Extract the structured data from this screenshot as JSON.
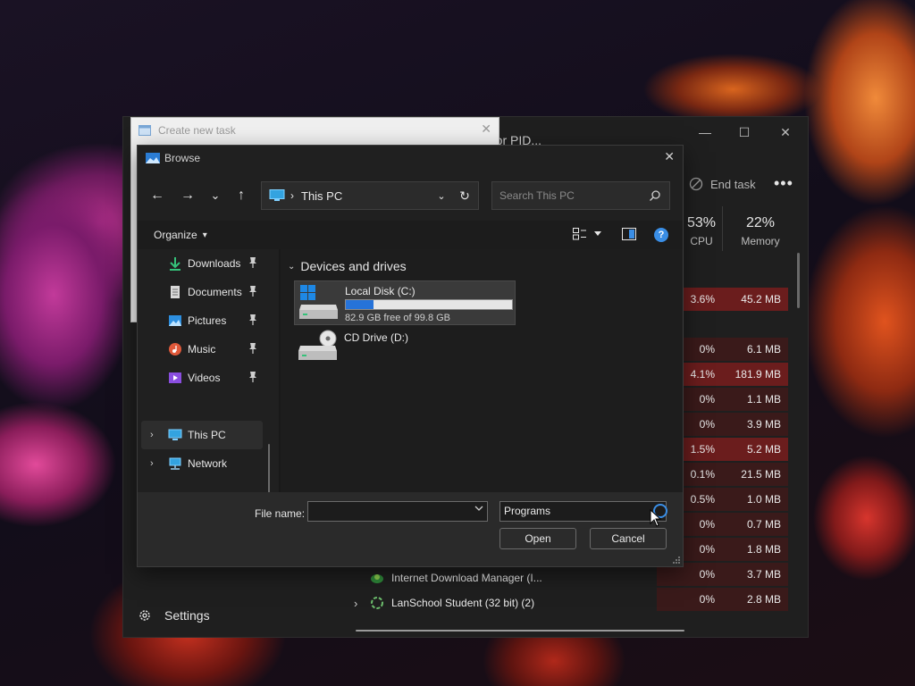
{
  "task_manager": {
    "search_partial": "r, or PID...",
    "controls": {
      "minimize": "—",
      "maximize": "☐",
      "close": "✕"
    },
    "end_task_label": "End task",
    "more_label": "•••",
    "cpu": {
      "percent": "53%",
      "label": "CPU"
    },
    "memory": {
      "percent": "22%",
      "label": "Memory"
    },
    "rows": [
      {
        "cpu": "3.6%",
        "mem": "45.2 MB",
        "highlight": true
      },
      {
        "cpu": "",
        "mem": "",
        "highlight": false
      },
      {
        "cpu": "0%",
        "mem": "6.1 MB",
        "highlight": false
      },
      {
        "cpu": "4.1%",
        "mem": "181.9 MB",
        "highlight": true
      },
      {
        "cpu": "0%",
        "mem": "1.1 MB",
        "highlight": false
      },
      {
        "cpu": "0%",
        "mem": "3.9 MB",
        "highlight": false
      },
      {
        "cpu": "1.5%",
        "mem": "5.2 MB",
        "highlight": true
      },
      {
        "cpu": "0.1%",
        "mem": "21.5 MB",
        "highlight": false
      },
      {
        "cpu": "0.5%",
        "mem": "1.0 MB",
        "highlight": false
      },
      {
        "cpu": "0%",
        "mem": "0.7 MB",
        "highlight": false
      },
      {
        "cpu": "0%",
        "mem": "1.8 MB",
        "highlight": false
      },
      {
        "cpu": "0%",
        "mem": "3.7 MB",
        "highlight": false
      },
      {
        "cpu": "0%",
        "mem": "2.8 MB",
        "highlight": false
      }
    ],
    "processes": [
      {
        "name": "Internet Download Manager (I...",
        "expand": ""
      },
      {
        "name": "LanSchool Student (32 bit) (2)",
        "expand": "›"
      }
    ],
    "settings_label": "Settings"
  },
  "create_task": {
    "title": "Create new task",
    "close": "✕"
  },
  "browse": {
    "title": "Browse",
    "close": "✕",
    "nav_buttons": {
      "back": "←",
      "forward": "→",
      "recent": "⌄",
      "up": "↑"
    },
    "address": {
      "location": "This PC",
      "separator": "›",
      "dropdown": "⌄",
      "refresh": "↻"
    },
    "search_placeholder": "Search This PC",
    "organize_label": "Organize",
    "organize_arrow": "▾",
    "help_label": "?",
    "nav_items": [
      {
        "label": "Downloads",
        "pin": "📌"
      },
      {
        "label": "Documents",
        "pin": "📌"
      },
      {
        "label": "Pictures",
        "pin": "📌"
      },
      {
        "label": "Music",
        "pin": "📌"
      },
      {
        "label": "Videos",
        "pin": "📌"
      },
      {
        "label": "This PC",
        "chevron": "›"
      },
      {
        "label": "Network",
        "chevron": "›"
      }
    ],
    "section_title": "Devices and drives",
    "section_chevron": "⌄",
    "drives": [
      {
        "name": "Local Disk (C:)",
        "free": "82.9 GB free of 99.8 GB",
        "used_fraction": 0.169
      },
      {
        "name": "CD Drive (D:)"
      }
    ],
    "file_name_label": "File name:",
    "file_name_value": "",
    "filter_value": "Programs",
    "open_label": "Open",
    "cancel_label": "Cancel"
  },
  "colors": {
    "accent": "#2673d9",
    "tm_highlight": "#6b1d1d",
    "tm_col_bg": "#3a1a1a"
  }
}
